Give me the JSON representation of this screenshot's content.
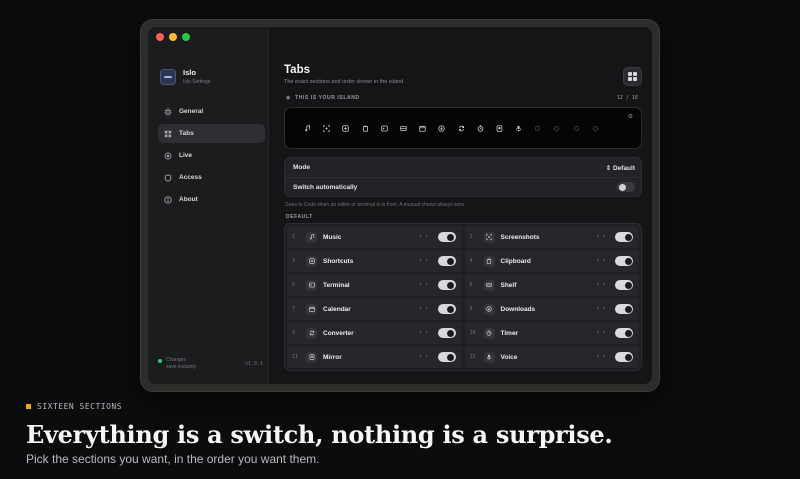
{
  "app": {
    "name": "Islo",
    "subtitle": "Islo Settings",
    "version": "v1.0.1",
    "save_note_line1": "Changes",
    "save_note_line2": "save instantly"
  },
  "sidebar": {
    "items": [
      {
        "label": "General",
        "icon": "gear-icon",
        "active": false
      },
      {
        "label": "Tabs",
        "icon": "grid-icon",
        "active": true
      },
      {
        "label": "Live",
        "icon": "pulse-icon",
        "active": false
      },
      {
        "label": "Access",
        "icon": "shield-icon",
        "active": false
      },
      {
        "label": "About",
        "icon": "info-icon",
        "active": false
      }
    ]
  },
  "page": {
    "title": "Tabs",
    "subtitle": "The exact sections and order shown in the island"
  },
  "island": {
    "heading": "THIS IS YOUR ISLAND",
    "count": "12 / 16",
    "icons": [
      "music-note-icon",
      "screenshot-icon",
      "shortcuts-icon",
      "clipboard-icon",
      "terminal-icon",
      "shelf-icon",
      "calendar-icon",
      "downloads-icon",
      "converter-icon",
      "timer-icon",
      "mirror-icon",
      "voice-icon",
      "extra-icon",
      "extra-icon",
      "extra-icon",
      "extra-icon"
    ],
    "active_count": 12
  },
  "mode": {
    "label": "Mode",
    "value": "Default",
    "auto_label": "Switch automatically",
    "auto_on": false,
    "hint": "Goes to Code when an editor or terminal is in front. A manual choice always wins."
  },
  "section_label": "DEFAULT",
  "tabs": [
    {
      "num": "1",
      "name": "Music",
      "icon": "music-note-icon",
      "on": true
    },
    {
      "num": "2",
      "name": "Screenshots",
      "icon": "screenshot-icon",
      "on": true
    },
    {
      "num": "3",
      "name": "Shortcuts",
      "icon": "shortcuts-icon",
      "on": true
    },
    {
      "num": "4",
      "name": "Clipboard",
      "icon": "clipboard-icon",
      "on": true
    },
    {
      "num": "5",
      "name": "Terminal",
      "icon": "terminal-icon",
      "on": true
    },
    {
      "num": "6",
      "name": "Shelf",
      "icon": "shelf-icon",
      "on": true
    },
    {
      "num": "7",
      "name": "Calendar",
      "icon": "calendar-icon",
      "on": true
    },
    {
      "num": "8",
      "name": "Downloads",
      "icon": "downloads-icon",
      "on": true
    },
    {
      "num": "9",
      "name": "Converter",
      "icon": "converter-icon",
      "on": true
    },
    {
      "num": "10",
      "name": "Timer",
      "icon": "timer-icon",
      "on": true
    },
    {
      "num": "11",
      "name": "Mirror",
      "icon": "mirror-icon",
      "on": true
    },
    {
      "num": "12",
      "name": "Voice",
      "icon": "voice-icon",
      "on": true
    }
  ],
  "marketing": {
    "kicker": "SIXTEEN SECTIONS",
    "headline": "Everything is a switch, nothing is a surprise.",
    "subline": "Pick the sections you want, in the order you want them."
  },
  "colors": {
    "accent": "#f5a524",
    "online": "#2ecc71",
    "background": "#0b0c0e"
  }
}
